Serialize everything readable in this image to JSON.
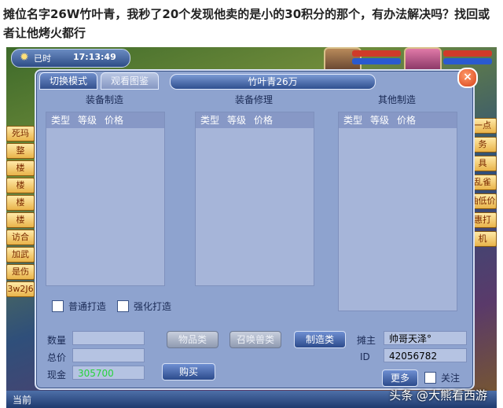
{
  "caption": "摊位名字26W竹叶青，我秒了20个发现他卖的是小的30积分的那个，有办法解决吗？找回或者让他烤火都行",
  "hud": {
    "status": "已时",
    "time": "17:13:49"
  },
  "side_left": [
    "死玛",
    "整",
    "楼",
    "楼",
    "楼",
    "楼",
    "访合",
    "加武",
    "是伤",
    "3w2J6"
  ],
  "side_right": [
    "一点",
    "务",
    "具",
    "乱雀",
    "抽低价",
    "惠打",
    "机"
  ],
  "dialog": {
    "tabs": [
      "切换模式",
      "观看图鉴"
    ],
    "title": "竹叶青26万",
    "close": "×",
    "sections": [
      "装备制造",
      "装备修理",
      "其他制造"
    ],
    "list_headers": [
      "类型",
      "等级",
      "价格"
    ],
    "checkboxes": [
      "普通打造",
      "强化打造"
    ],
    "qty_label": "数量",
    "total_label": "总价",
    "cash_label": "现金",
    "cash_value": "305700",
    "category_buttons": [
      "物品类",
      "召唤兽类",
      "制造类"
    ],
    "buy_button": "购买",
    "owner_label": "摊主",
    "owner_value": "帅哥天泽°",
    "id_label": "ID",
    "id_value": "42056782",
    "more_button": "更多",
    "follow_label": "关注"
  },
  "bottom": {
    "current": "当前"
  },
  "watermark": "头条 @大熊看西游",
  "colors": {
    "panel": "#8ea3cf",
    "accent": "#2c4b8c",
    "cash": "#27d43b"
  }
}
